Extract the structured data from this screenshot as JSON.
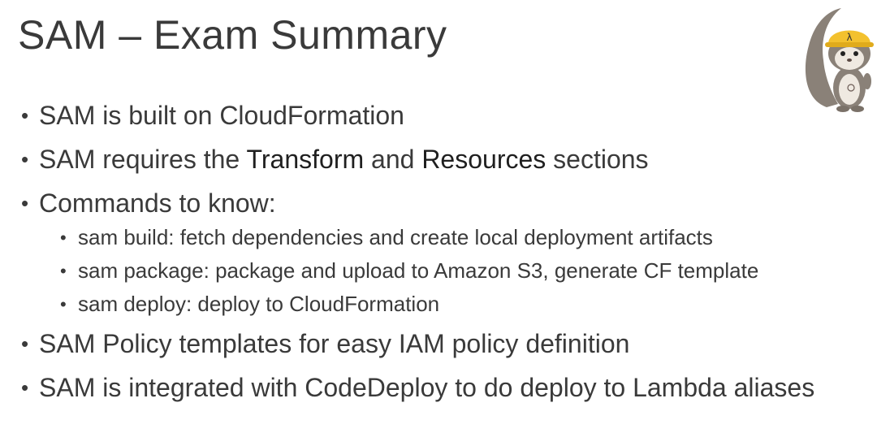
{
  "slide": {
    "title": "SAM – Exam Summary"
  },
  "mascot": {
    "icon": "squirrel-lambda-helmet-icon",
    "helmet_glyph": "λ",
    "colors": {
      "fur": "#8a8178",
      "face": "#efe9e1",
      "helmet": "#f3c12e"
    }
  },
  "bullets": {
    "b1": "SAM is built on CloudFormation",
    "b2": {
      "pre": "SAM requires the ",
      "kw1": "Transform",
      "mid": " and ",
      "kw2": "Resources",
      "post": " sections"
    },
    "b3": "Commands to know:",
    "commands": [
      "sam build: fetch dependencies and create local deployment artifacts",
      "sam package: package and upload to Amazon S3, generate CF template",
      "sam deploy: deploy to CloudFormation"
    ],
    "b4": "SAM Policy templates for easy IAM policy definition",
    "b5": "SAM is integrated with CodeDeploy to do deploy to Lambda aliases"
  }
}
